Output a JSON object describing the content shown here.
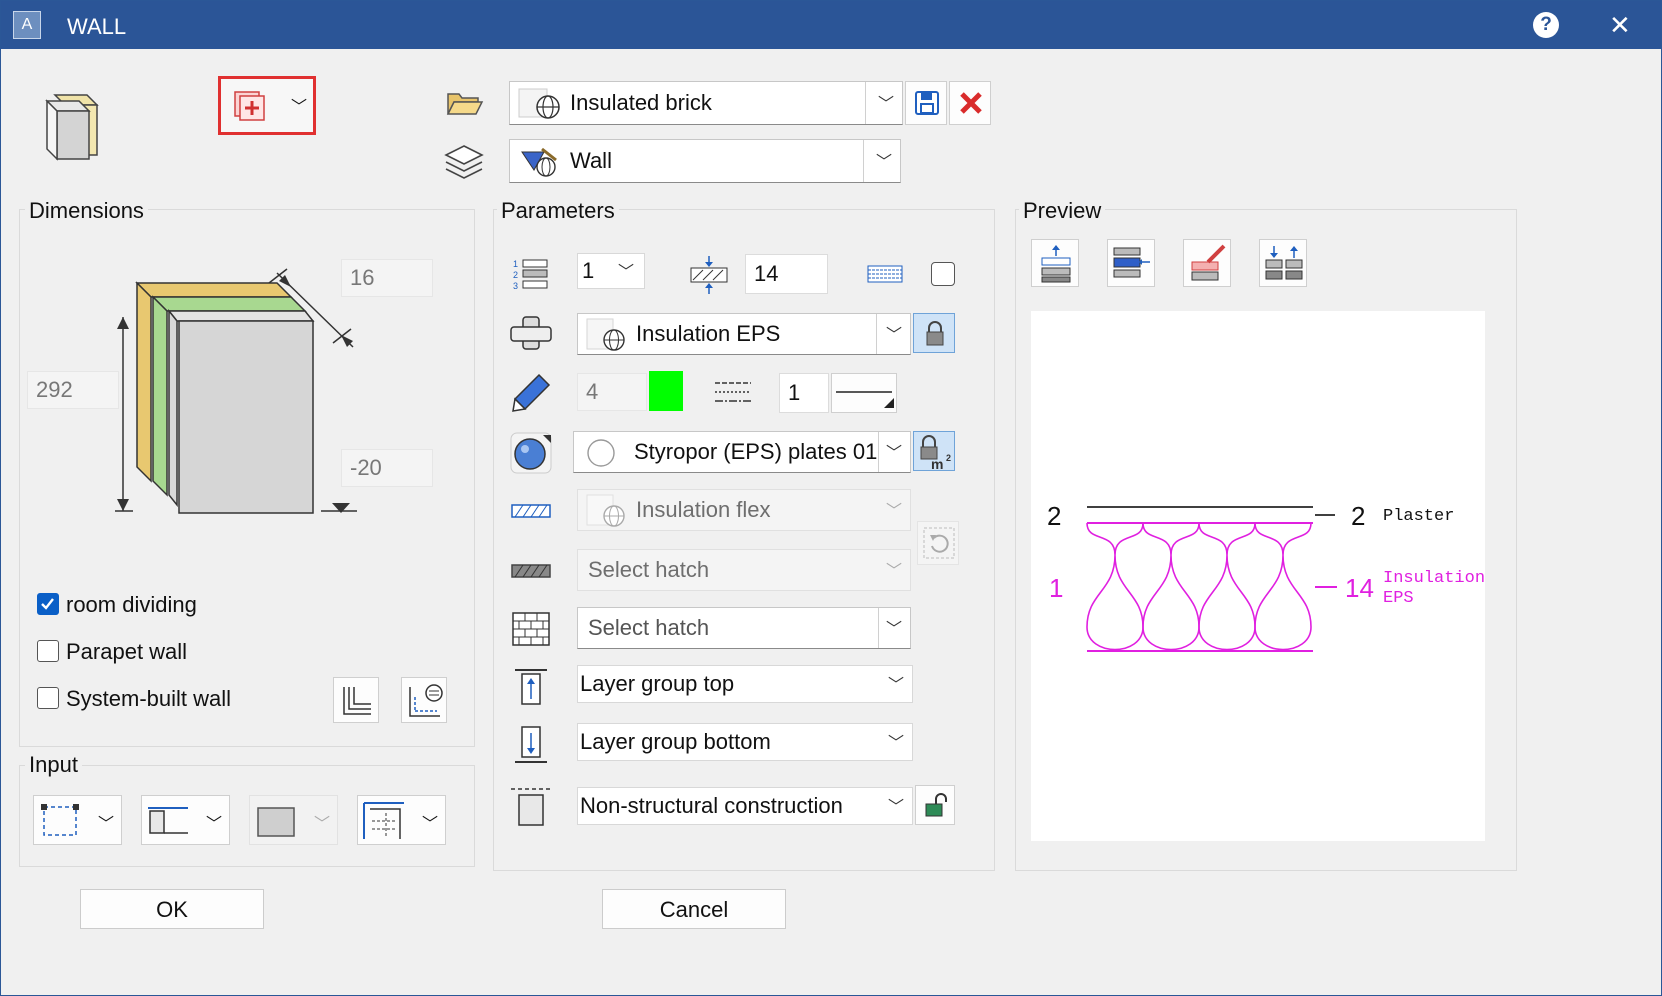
{
  "window": {
    "title": "WALL",
    "app_icon_letter": "A",
    "help_glyph": "?",
    "close_glyph": "✕"
  },
  "top": {
    "material_combo": "Insulated brick",
    "layer_combo": "Wall"
  },
  "dimensions": {
    "title": "Dimensions",
    "thickness": "16",
    "height": "292",
    "offset": "-20",
    "options": [
      {
        "label": "room dividing",
        "checked": true
      },
      {
        "label": "Parapet wall",
        "checked": false
      },
      {
        "label": "System-built wall",
        "checked": false
      }
    ]
  },
  "input": {
    "title": "Input"
  },
  "parameters": {
    "title": "Parameters",
    "layer_number": "1",
    "layer_thickness": "14",
    "material": "Insulation EPS",
    "pen_value": "4",
    "line_value": "1",
    "surface": "Styropor (EPS) plates 01",
    "pattern": "Insulation flex",
    "hatch1": "Select hatch",
    "hatch2": "Select hatch",
    "layer_group_top": "Layer group top",
    "layer_group_bottom": "Layer group bottom",
    "construction": "Non-structural construction"
  },
  "preview": {
    "title": "Preview",
    "left_top_num": "2",
    "left_mid_num": "1",
    "right_top_num": "2",
    "right_top_label": "Plaster",
    "right_mid_num": "14",
    "right_mid_label_1": "Insulation",
    "right_mid_label_2": "EPS"
  },
  "buttons": {
    "ok": "OK",
    "cancel": "Cancel"
  },
  "colors": {
    "title_bar": "#2b5597",
    "pen_color": "#00ff00",
    "insulation": "#e020e0",
    "highlight": "#e03030",
    "checkbox": "#0a5fc7"
  }
}
